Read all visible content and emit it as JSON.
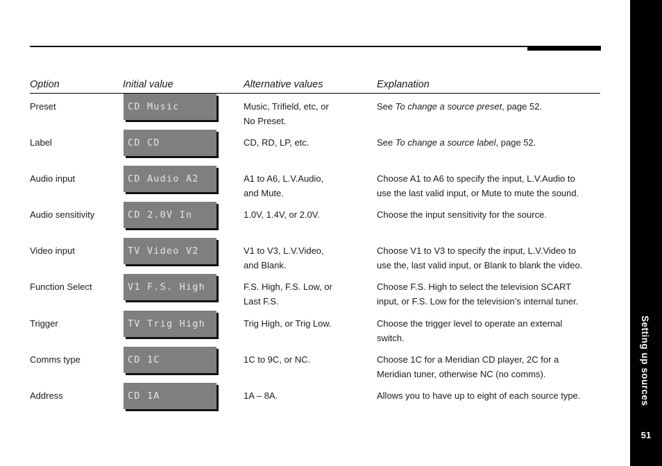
{
  "side_tab": {
    "title": "Setting up sources",
    "page_number": "51"
  },
  "table": {
    "headers": {
      "option": "Option",
      "initial": "Initial value",
      "alternatives": "Alternative values",
      "explanation": "Explanation"
    },
    "rows": [
      {
        "option": "Preset",
        "initial": "CD Music",
        "alt1": "Music, Trifield, etc, or",
        "alt2": "No Preset.",
        "exp_pre": "See ",
        "exp_em": "To change a source preset",
        "exp_post": ", page 52.",
        "exp2": ""
      },
      {
        "option": "Label",
        "initial": "CD CD",
        "alt1": "CD, RD, LP, etc.",
        "alt2": "",
        "exp_pre": "See ",
        "exp_em": "To change a source label",
        "exp_post": ", page 52.",
        "exp2": ""
      },
      {
        "option": "Audio input",
        "initial": "CD Audio A2",
        "alt1": "A1 to A6, L.V.Audio,",
        "alt2": "and Mute.",
        "exp_pre": "Choose A1 to A6 to specify the input, L.V.Audio to",
        "exp_em": "",
        "exp_post": "",
        "exp2": "use the last valid input, or Mute to mute the sound."
      },
      {
        "option": "Audio sensitivity",
        "initial": "CD 2.0V In",
        "alt1": "1.0V, 1.4V, or 2.0V.",
        "alt2": "",
        "exp_pre": "Choose the input sensitivity for the source.",
        "exp_em": "",
        "exp_post": "",
        "exp2": ""
      },
      {
        "option": "Video input",
        "initial": "TV Video V2",
        "alt1": "V1 to V3, L.V.Video,",
        "alt2": "and Blank.",
        "exp_pre": "Choose V1 to V3 to specify the input, L.V.Video to",
        "exp_em": "",
        "exp_post": "",
        "exp2": "use the, last valid input, or Blank to blank the video."
      },
      {
        "option": "Function Select",
        "initial": "V1 F.S. High",
        "alt1": "F.S. High, F.S. Low, or",
        "alt2": "Last F.S.",
        "exp_pre": "Choose F.S. High to select the television SCART",
        "exp_em": "",
        "exp_post": "",
        "exp2": "input, or F.S. Low for the television’s internal tuner."
      },
      {
        "option": "Trigger",
        "initial": "TV Trig High",
        "alt1": "Trig High, or Trig Low.",
        "alt2": "",
        "exp_pre": "Choose the trigger level to operate an external",
        "exp_em": "",
        "exp_post": "",
        "exp2": "switch."
      },
      {
        "option": "Comms type",
        "initial": "CD 1C",
        "alt1": "1C to 9C, or NC.",
        "alt2": "",
        "exp_pre": "Choose 1C for a Meridian CD player, 2C for a",
        "exp_em": "",
        "exp_post": "",
        "exp2": "Meridian tuner, otherwise NC (no comms)."
      },
      {
        "option": "Address",
        "initial": "CD 1A",
        "alt1": "1A – 8A.",
        "alt2": "",
        "exp_pre": "Allows you to have up to eight of each source type.",
        "exp_em": "",
        "exp_post": "",
        "exp2": ""
      }
    ]
  }
}
